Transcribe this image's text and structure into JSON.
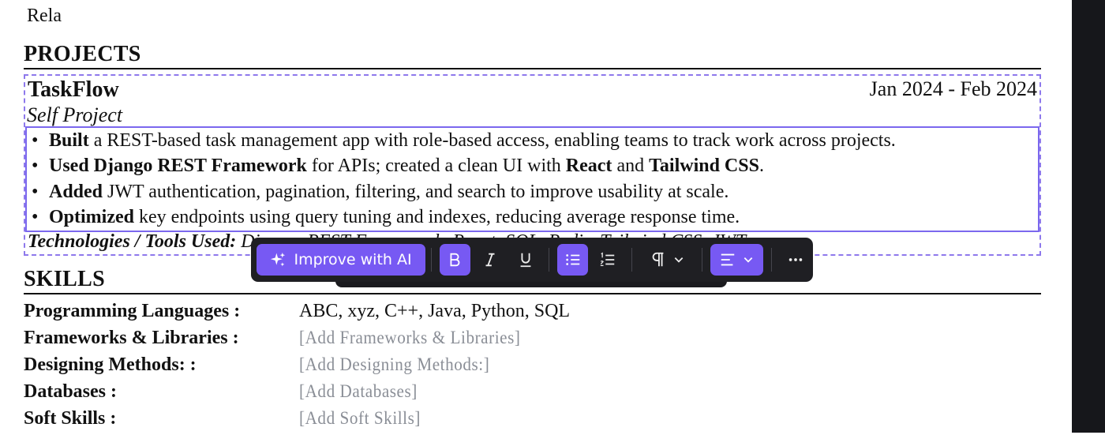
{
  "partial_top_text": "Rela",
  "sections": {
    "projects": "PROJECTS",
    "skills": "SKILLS"
  },
  "project": {
    "title": "TaskFlow",
    "dates": "Jan 2024 - Feb 2024",
    "subtitle": "Self Project",
    "bullets": [
      {
        "parts": [
          {
            "b": "Built"
          },
          {
            "t": " a REST-based task management app with role-based access, enabling teams to track work across projects."
          }
        ]
      },
      {
        "parts": [
          {
            "b": "Used Django REST Framework"
          },
          {
            "t": " for APIs; created a clean UI with "
          },
          {
            "b": "React"
          },
          {
            "t": " and "
          },
          {
            "b": "Tailwind CSS"
          },
          {
            "t": "."
          }
        ]
      },
      {
        "parts": [
          {
            "b": "Added"
          },
          {
            "t": " JWT authentication, pagination, filtering, and search to improve usability at scale."
          }
        ]
      },
      {
        "parts": [
          {
            "b": "Optimized"
          },
          {
            "t": " key endpoints using query tuning and indexes, reducing average response time."
          }
        ]
      }
    ],
    "tech_label": "Technologies / Tools Used:",
    "tech_value": " Django, REST Framework, React, SQL, Redis, Tailwind CSS, JWT"
  },
  "toolbar": {
    "ai_label": "Improve with AI",
    "icons": [
      "sparkle-icon",
      "bold-icon",
      "italic-icon",
      "underline-icon",
      "bullet-list-icon",
      "numbered-list-icon",
      "paragraph-icon",
      "chevron-down-icon",
      "align-left-icon",
      "more-icon"
    ],
    "accent": "#7759f3"
  },
  "skills": [
    {
      "label": "Programming Languages :",
      "value": "ABC, xyz, C++, Java, Python, SQL",
      "placeholder": false
    },
    {
      "label": "Frameworks & Libraries :",
      "value": "[Add Frameworks & Libraries]",
      "placeholder": true
    },
    {
      "label": "Designing Methods: :",
      "value": "[Add Designing Methods:]",
      "placeholder": true
    },
    {
      "label": "Databases :",
      "value": "[Add Databases]",
      "placeholder": true
    },
    {
      "label": "Soft Skills :",
      "value": "[Add Soft Skills]",
      "placeholder": true
    }
  ]
}
